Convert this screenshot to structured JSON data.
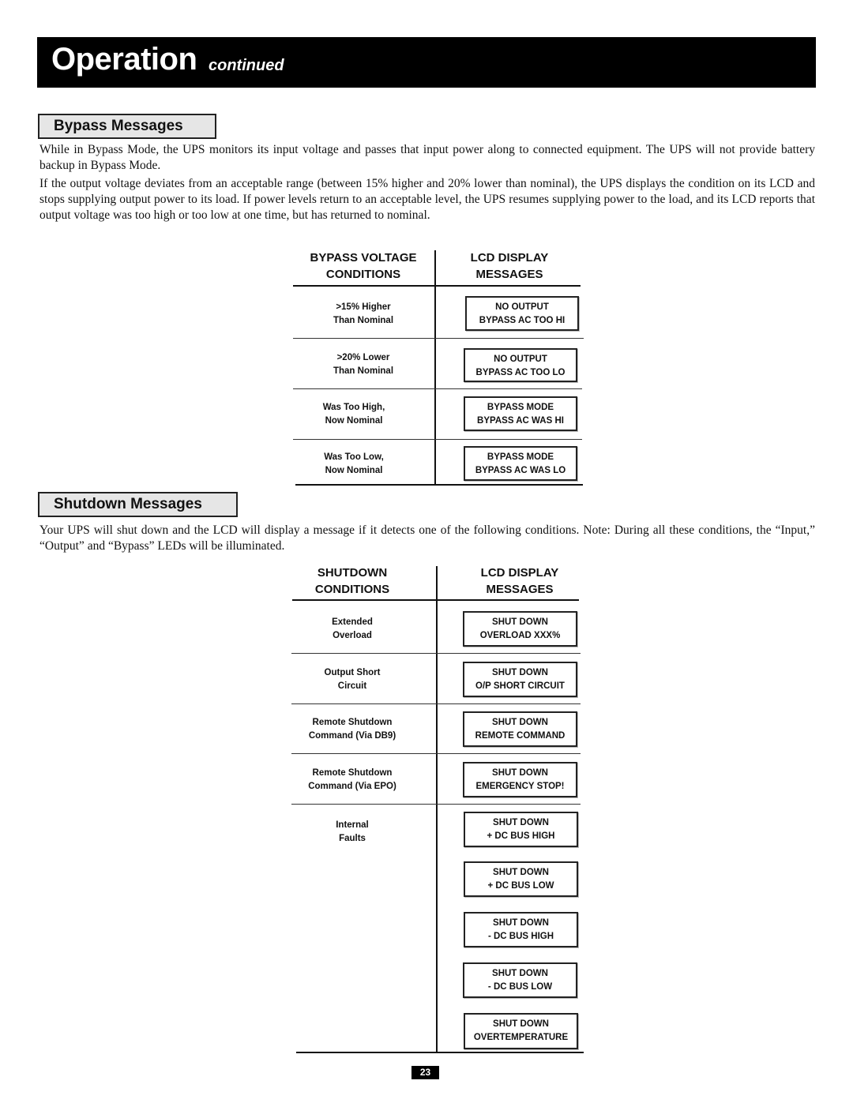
{
  "header": {
    "title": "Operation",
    "subtitle": "continued"
  },
  "bypass": {
    "section_title": "Bypass Messages",
    "paragraphs": [
      "While in Bypass Mode, the UPS monitors its input voltage and passes that input power along to connected equipment. The UPS will not provide battery backup in Bypass Mode.",
      "If the output voltage deviates from an acceptable range (between 15% higher and 20% lower than nominal), the UPS displays the condition on its LCD and stops supplying output power to its load. If power levels return to an acceptable level, the UPS resumes supplying power to the load, and its LCD reports that output voltage was too high or too low at one time, but has returned to nominal."
    ],
    "table": {
      "col1_header": [
        "BYPASS VOLTAGE",
        "CONDITIONS"
      ],
      "col2_header": [
        "LCD DISPLAY",
        "MESSAGES"
      ],
      "rows": [
        {
          "condition": [
            ">15% Higher",
            "Than Nominal"
          ],
          "messages": [
            [
              "NO OUTPUT",
              "BYPASS AC TOO HI"
            ]
          ]
        },
        {
          "condition": [
            ">20% Lower",
            "Than Nominal"
          ],
          "messages": [
            [
              "NO OUTPUT",
              "BYPASS AC TOO LO"
            ]
          ]
        },
        {
          "condition": [
            "Was Too High,",
            "Now Nominal"
          ],
          "messages": [
            [
              "BYPASS MODE",
              "BYPASS AC WAS HI"
            ]
          ]
        },
        {
          "condition": [
            "Was Too Low,",
            "Now Nominal"
          ],
          "messages": [
            [
              "BYPASS MODE",
              "BYPASS AC WAS LO"
            ]
          ]
        }
      ]
    }
  },
  "shutdown": {
    "section_title": "Shutdown Messages",
    "paragraph": "Your UPS will shut down and the LCD will display a message if it detects one of the following conditions. Note: During all these conditions, the “Input,” “Output” and “Bypass” LEDs will be illuminated.",
    "table": {
      "col1_header": [
        "SHUTDOWN",
        "CONDITIONS"
      ],
      "col2_header": [
        "LCD DISPLAY",
        "MESSAGES"
      ],
      "rows": [
        {
          "condition": [
            "Extended",
            "Overload"
          ],
          "messages": [
            [
              "SHUT DOWN",
              "OVERLOAD XXX%"
            ]
          ]
        },
        {
          "condition": [
            "Output Short",
            "Circuit"
          ],
          "messages": [
            [
              "SHUT DOWN",
              "O/P SHORT CIRCUIT"
            ]
          ]
        },
        {
          "condition": [
            "Remote Shutdown",
            "Command (Via DB9)"
          ],
          "messages": [
            [
              "SHUT DOWN",
              "REMOTE COMMAND"
            ]
          ]
        },
        {
          "condition": [
            "Remote Shutdown",
            "Command (Via EPO)"
          ],
          "messages": [
            [
              "SHUT DOWN",
              "EMERGENCY STOP!"
            ]
          ]
        },
        {
          "condition": [
            "Internal",
            "Faults"
          ],
          "messages": [
            [
              "SHUT DOWN",
              "+ DC BUS HIGH"
            ],
            [
              "SHUT DOWN",
              "+ DC BUS LOW"
            ],
            [
              "SHUT DOWN",
              "- DC BUS HIGH"
            ],
            [
              "SHUT DOWN",
              "- DC BUS LOW"
            ],
            [
              "SHUT DOWN",
              "OVERTEMPERATURE"
            ]
          ]
        }
      ]
    }
  },
  "footer": {
    "page_number": "23"
  }
}
